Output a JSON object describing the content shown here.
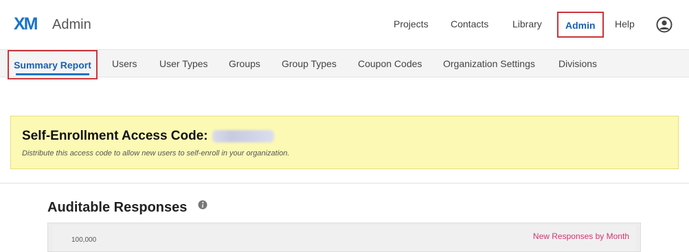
{
  "app": {
    "logo": "XM",
    "title": "Admin"
  },
  "topnav": {
    "items": [
      {
        "label": "Projects"
      },
      {
        "label": "Contacts"
      },
      {
        "label": "Library"
      },
      {
        "label": "Admin",
        "active": true
      },
      {
        "label": "Help"
      }
    ]
  },
  "tabs": {
    "items": [
      {
        "label": "Summary Report",
        "active": true
      },
      {
        "label": "Users"
      },
      {
        "label": "User Types"
      },
      {
        "label": "Groups"
      },
      {
        "label": "Group Types"
      },
      {
        "label": "Coupon Codes"
      },
      {
        "label": "Organization Settings"
      },
      {
        "label": "Divisions"
      }
    ]
  },
  "banner": {
    "title": "Self-Enrollment Access Code:",
    "description": "Distribute this access code to allow new users to self-enroll in your organization."
  },
  "responses": {
    "title": "Auditable Responses",
    "chart_data": {
      "type": "line",
      "title": "New Responses by Month",
      "y_tick_labels": [
        "100,000"
      ]
    }
  },
  "colors": {
    "accent": "#1a73c9",
    "highlight_border": "#c9343a",
    "banner_bg": "#fcf9b5",
    "legend": "#d4336f"
  }
}
